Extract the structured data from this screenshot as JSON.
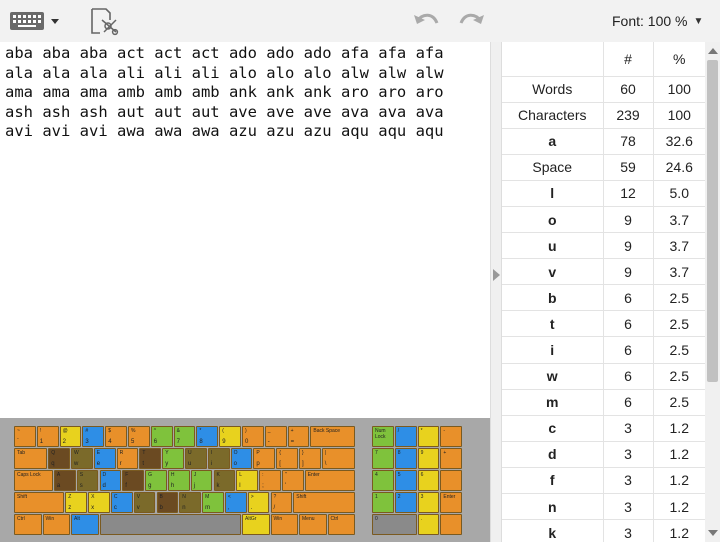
{
  "toolbar": {
    "keyboard_icon": "keyboard-icon",
    "clear_icon": "clear-text-icon",
    "undo_icon": "undo-icon",
    "redo_icon": "redo-icon",
    "font_label": "Font: 100 %"
  },
  "text": {
    "lines": [
      "aba aba aba act act act ado ado ado afa afa afa",
      "ala ala ala ali ali ali alo alo alo alw alw alw",
      "ama ama ama amb amb amb ank ank ank aro aro aro",
      "ash ash ash aut aut aut ave ave ave ava ava ava",
      "avi avi avi awa awa awa azu azu azu aqu aqu aqu"
    ]
  },
  "stats": {
    "headers": [
      "",
      "#",
      "%"
    ],
    "rows": [
      {
        "label": "Words",
        "count": "60",
        "pct": "100",
        "bold": false
      },
      {
        "label": "Characters",
        "count": "239",
        "pct": "100",
        "bold": false
      },
      {
        "label": "a",
        "count": "78",
        "pct": "32.6",
        "bold": true
      },
      {
        "label": "Space",
        "count": "59",
        "pct": "24.6",
        "bold": false
      },
      {
        "label": "l",
        "count": "12",
        "pct": "5.0",
        "bold": true
      },
      {
        "label": "o",
        "count": "9",
        "pct": "3.7",
        "bold": true
      },
      {
        "label": "u",
        "count": "9",
        "pct": "3.7",
        "bold": true
      },
      {
        "label": "v",
        "count": "9",
        "pct": "3.7",
        "bold": true
      },
      {
        "label": "b",
        "count": "6",
        "pct": "2.5",
        "bold": true
      },
      {
        "label": "t",
        "count": "6",
        "pct": "2.5",
        "bold": true
      },
      {
        "label": "i",
        "count": "6",
        "pct": "2.5",
        "bold": true
      },
      {
        "label": "w",
        "count": "6",
        "pct": "2.5",
        "bold": true
      },
      {
        "label": "m",
        "count": "6",
        "pct": "2.5",
        "bold": true
      },
      {
        "label": "c",
        "count": "3",
        "pct": "1.2",
        "bold": true
      },
      {
        "label": "d",
        "count": "3",
        "pct": "1.2",
        "bold": true
      },
      {
        "label": "f",
        "count": "3",
        "pct": "1.2",
        "bold": true
      },
      {
        "label": "n",
        "count": "3",
        "pct": "1.2",
        "bold": true
      },
      {
        "label": "k",
        "count": "3",
        "pct": "1.2",
        "bold": true
      }
    ]
  },
  "keyboard": {
    "colors": {
      "orange": "#e8902a",
      "yellow": "#e8d21e",
      "green": "#7fc23c",
      "blue": "#2e8ee6",
      "gray": "#8a8a8a",
      "dark": "#6b4a22",
      "olive": "#7b6a2a"
    },
    "rows": [
      {
        "keys": [
          {
            "t": "~",
            "b": "`",
            "c": "orange"
          },
          {
            "t": "!",
            "b": "1",
            "c": "orange"
          },
          {
            "t": "@",
            "b": "2",
            "c": "yellow"
          },
          {
            "t": "#",
            "b": "3",
            "c": "blue"
          },
          {
            "t": "$",
            "b": "4",
            "c": "orange"
          },
          {
            "t": "%",
            "b": "5",
            "c": "orange"
          },
          {
            "t": "^",
            "b": "6",
            "c": "green"
          },
          {
            "t": "&",
            "b": "7",
            "c": "green"
          },
          {
            "t": "*",
            "b": "8",
            "c": "blue"
          },
          {
            "t": "(",
            "b": "9",
            "c": "yellow"
          },
          {
            "t": ")",
            "b": "0",
            "c": "orange"
          },
          {
            "t": "_",
            "b": "-",
            "c": "orange"
          },
          {
            "t": "+",
            "b": "=",
            "c": "orange"
          },
          {
            "t": "Back Space",
            "b": "",
            "c": "orange",
            "w": 2
          }
        ]
      },
      {
        "keys": [
          {
            "t": "Tab",
            "b": "",
            "c": "orange",
            "w": 1.5
          },
          {
            "t": "Q",
            "b": "q",
            "c": "dark"
          },
          {
            "t": "W",
            "b": "w",
            "c": "olive"
          },
          {
            "t": "E",
            "b": "e",
            "c": "blue"
          },
          {
            "t": "R",
            "b": "r",
            "c": "orange"
          },
          {
            "t": "T",
            "b": "t",
            "c": "dark"
          },
          {
            "t": "Y",
            "b": "y",
            "c": "green"
          },
          {
            "t": "U",
            "b": "u",
            "c": "olive"
          },
          {
            "t": "I",
            "b": "i",
            "c": "olive"
          },
          {
            "t": "O",
            "b": "o",
            "c": "blue"
          },
          {
            "t": "P",
            "b": "p",
            "c": "orange"
          },
          {
            "t": "{",
            "b": "[",
            "c": "orange"
          },
          {
            "t": "}",
            "b": "]",
            "c": "orange"
          },
          {
            "t": "|",
            "b": "\\",
            "c": "orange",
            "w": 1.5
          }
        ]
      },
      {
        "keys": [
          {
            "t": "Caps Lock",
            "b": "",
            "c": "orange",
            "w": 1.75
          },
          {
            "t": "A",
            "b": "a",
            "c": "dark"
          },
          {
            "t": "S",
            "b": "s",
            "c": "olive"
          },
          {
            "t": "D",
            "b": "d",
            "c": "blue"
          },
          {
            "t": "F",
            "b": "f",
            "c": "dark"
          },
          {
            "t": "G",
            "b": "g",
            "c": "green"
          },
          {
            "t": "H",
            "b": "h",
            "c": "green"
          },
          {
            "t": "J",
            "b": "j",
            "c": "green"
          },
          {
            "t": "K",
            "b": "k",
            "c": "olive"
          },
          {
            "t": "L",
            "b": "l",
            "c": "yellow"
          },
          {
            "t": ":",
            "b": ";",
            "c": "orange"
          },
          {
            "t": "\"",
            "b": "'",
            "c": "orange"
          },
          {
            "t": "Enter",
            "b": "",
            "c": "orange",
            "w": 2.25
          }
        ]
      },
      {
        "keys": [
          {
            "t": "Shift",
            "b": "",
            "c": "orange",
            "w": 2.25
          },
          {
            "t": "Z",
            "b": "z",
            "c": "yellow"
          },
          {
            "t": "X",
            "b": "x",
            "c": "yellow"
          },
          {
            "t": "C",
            "b": "c",
            "c": "blue"
          },
          {
            "t": "V",
            "b": "v",
            "c": "olive"
          },
          {
            "t": "B",
            "b": "b",
            "c": "dark"
          },
          {
            "t": "N",
            "b": "n",
            "c": "olive"
          },
          {
            "t": "M",
            "b": "m",
            "c": "green"
          },
          {
            "t": "<",
            "b": ",",
            "c": "blue"
          },
          {
            "t": ">",
            "b": ".",
            "c": "yellow"
          },
          {
            "t": "?",
            "b": "/",
            "c": "orange"
          },
          {
            "t": "Shift",
            "b": "",
            "c": "orange",
            "w": 2.75
          }
        ]
      },
      {
        "keys": [
          {
            "t": "Ctrl",
            "b": "",
            "c": "orange",
            "w": 1.25
          },
          {
            "t": "Win",
            "b": "",
            "c": "orange",
            "w": 1.25
          },
          {
            "t": "Alt",
            "b": "",
            "c": "blue",
            "w": 1.25
          },
          {
            "t": "",
            "b": "",
            "c": "gray",
            "w": 6.25
          },
          {
            "t": "AltGr",
            "b": "",
            "c": "yellow",
            "w": 1.25
          },
          {
            "t": "Win",
            "b": "",
            "c": "orange",
            "w": 1.25
          },
          {
            "t": "Menu",
            "b": "",
            "c": "orange",
            "w": 1.25
          },
          {
            "t": "Ctrl",
            "b": "",
            "c": "orange",
            "w": 1.25
          }
        ]
      }
    ],
    "numpad": [
      [
        {
          "t": "Num Lock",
          "c": "green"
        },
        {
          "t": "/",
          "c": "blue"
        },
        {
          "t": "*",
          "c": "yellow"
        },
        {
          "t": "-",
          "c": "orange"
        }
      ],
      [
        {
          "t": "7",
          "c": "green"
        },
        {
          "t": "8",
          "c": "blue"
        },
        {
          "t": "9",
          "c": "yellow"
        },
        {
          "t": "+",
          "c": "orange"
        }
      ],
      [
        {
          "t": "4",
          "c": "green"
        },
        {
          "t": "5",
          "c": "blue"
        },
        {
          "t": "6",
          "c": "yellow"
        },
        {
          "t": "",
          "c": "orange"
        }
      ],
      [
        {
          "t": "1",
          "c": "green"
        },
        {
          "t": "2",
          "c": "blue"
        },
        {
          "t": "3",
          "c": "yellow"
        },
        {
          "t": "Enter",
          "c": "orange"
        }
      ],
      [
        {
          "t": "0",
          "c": "gray"
        },
        {
          "t": "",
          "c": "gray"
        },
        {
          "t": ".",
          "c": "yellow"
        },
        {
          "t": "",
          "c": "orange"
        }
      ]
    ]
  }
}
